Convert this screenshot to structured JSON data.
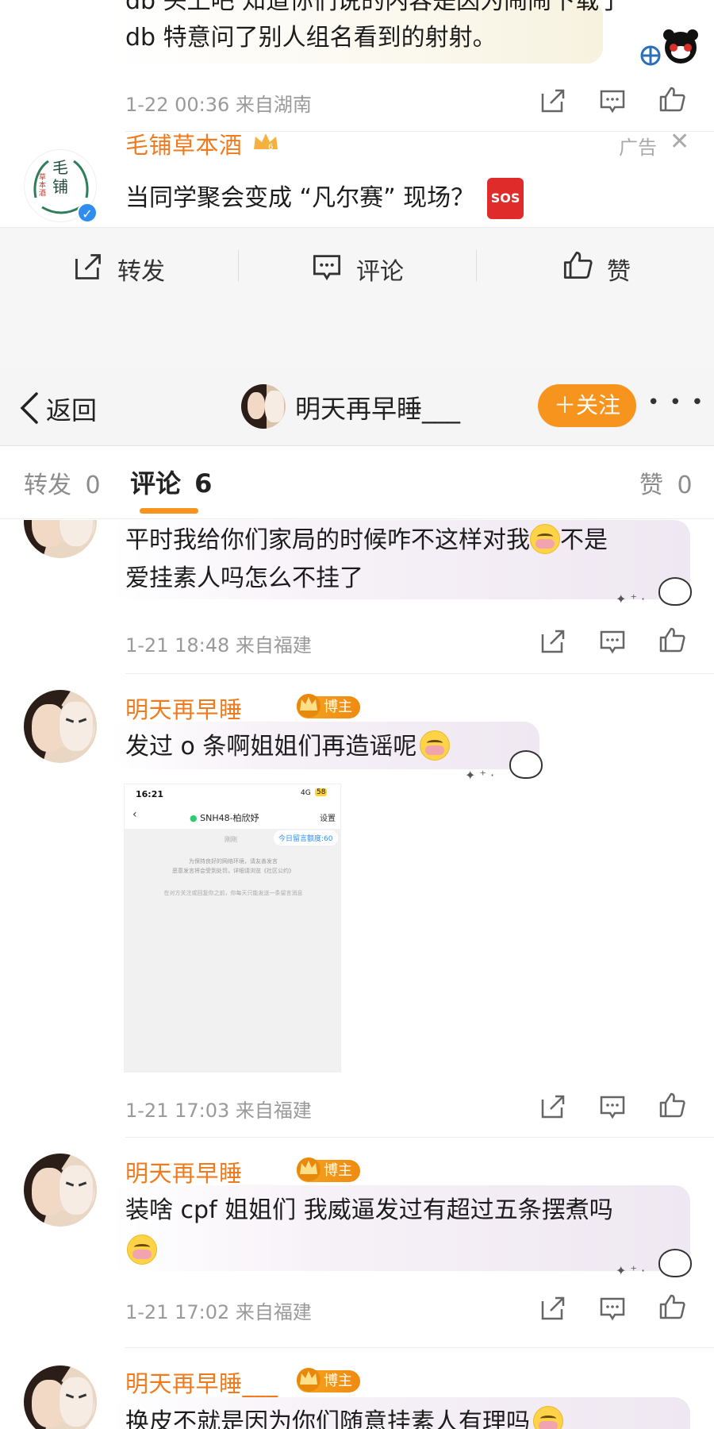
{
  "top_post": {
    "text_line1": "db 头上吧 知道你们说的内容是因为闹闹下载了",
    "text_line2": "db 特意问了别人组名看到的射射。",
    "meta": "1-22 00:36  来自湖南"
  },
  "ad": {
    "name": "毛铺草本酒",
    "label": "广告",
    "text": "当同学聚会变成 “凡尔赛” 现场？",
    "sos_badge": "SOS",
    "avatar_text_a": "毛铺",
    "avatar_text_b": "草本酒"
  },
  "action_bar": {
    "repost": "转发",
    "comment": "评论",
    "like": "赞"
  },
  "header": {
    "back": "返回",
    "title": "明天再早睡___",
    "follow": "＋关注",
    "more": "• • •"
  },
  "tabs": {
    "repost": "转发",
    "repost_count": "0",
    "comments": "评论",
    "comments_count": "6",
    "likes": "赞",
    "likes_count": "0"
  },
  "comments": [
    {
      "text_line1": "平时我给你们家局的时候咋不这样对我",
      "text_line1_tail": "不是",
      "text_line2": "爱挂素人吗怎么不挂了",
      "meta": "1-21 18:48  来自福建"
    },
    {
      "name": "明天再早睡___",
      "badge": "博主",
      "text": "发过 o 条啊姐姐们再造谣呢",
      "meta": "1-21 17:03  来自福建",
      "screenshot": {
        "time": "16:21",
        "signal": "4G",
        "battery": "58",
        "title": "SNH48-柏欣妤",
        "settings": "设置",
        "quota": "今日留言额度:60",
        "tab": "刚刚",
        "notice1": "为保持良好的网络环境，请友善发言",
        "notice2": "恶意发言将会受到处罚，详细请浏览《社区公约》",
        "notice3": "在对方关注或回复你之前，你每天只能发送一条留言消息"
      }
    },
    {
      "name": "明天再早睡___",
      "badge": "博主",
      "text": "装啥 cpf 姐姐们 我威逼发过有超过五条摆煮吗",
      "meta": "1-21 17:02  来自福建"
    },
    {
      "name": "明天再早睡___",
      "badge": "博主",
      "text": "换皮不就是因为你们随意挂素人有理吗"
    }
  ],
  "colors": {
    "accent": "#f07b1f",
    "follow_bg": "#f7941d",
    "meta": "#9a9a9a",
    "badge": "#f5a623"
  }
}
